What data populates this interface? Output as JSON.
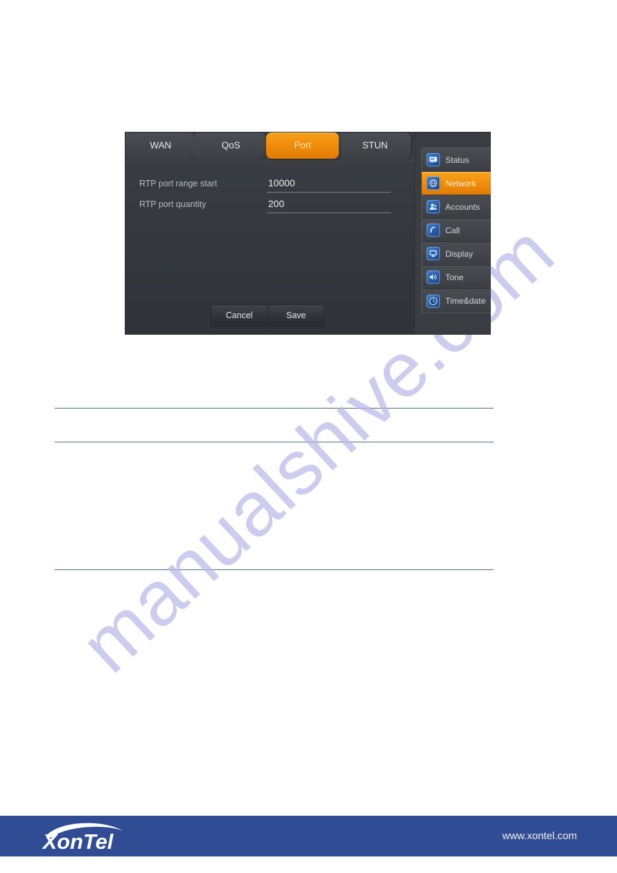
{
  "page": {
    "background_color": "#ffffff",
    "watermark_text": "manualshive.com"
  },
  "device_screen": {
    "tabs": [
      {
        "label": "WAN",
        "active": false,
        "name": "tab-wan"
      },
      {
        "label": "QoS",
        "active": false,
        "name": "tab-qos"
      },
      {
        "label": "Port",
        "active": true,
        "name": "tab-port"
      },
      {
        "label": "STUN",
        "active": false,
        "name": "tab-stun"
      }
    ],
    "form": {
      "fields": [
        {
          "label": "RTP port range start",
          "value": "10000"
        },
        {
          "label": "RTP port quantity",
          "value": "200"
        }
      ]
    },
    "buttons": {
      "cancel_label": "Cancel",
      "save_label": "Save"
    },
    "menu": {
      "items": [
        {
          "label": "Status",
          "icon": "status-icon",
          "active": false
        },
        {
          "label": "Network",
          "icon": "network-icon",
          "active": true
        },
        {
          "label": "Accounts",
          "icon": "accounts-icon",
          "active": false
        },
        {
          "label": "Call",
          "icon": "call-icon",
          "active": false
        },
        {
          "label": "Display",
          "icon": "display-icon",
          "active": false
        },
        {
          "label": "Tone",
          "icon": "tone-icon",
          "active": false
        },
        {
          "label": "Time&date",
          "icon": "clock-icon",
          "active": false
        }
      ]
    },
    "colors": {
      "panel_bg": "#34373c",
      "tab_bg": "#43464b",
      "accent_orange": "#f08c0a",
      "active_tab_text": "#ffe9a8",
      "label_text": "#b7bbc0",
      "value_text": "#eef0f2",
      "icon_blue": "#2c5fa8"
    }
  },
  "footer": {
    "brand": "XonTel",
    "url": "www.xontel.com",
    "background_color": "#2f4c95"
  },
  "rules": {
    "color": "#4a6d86",
    "count": 3
  }
}
